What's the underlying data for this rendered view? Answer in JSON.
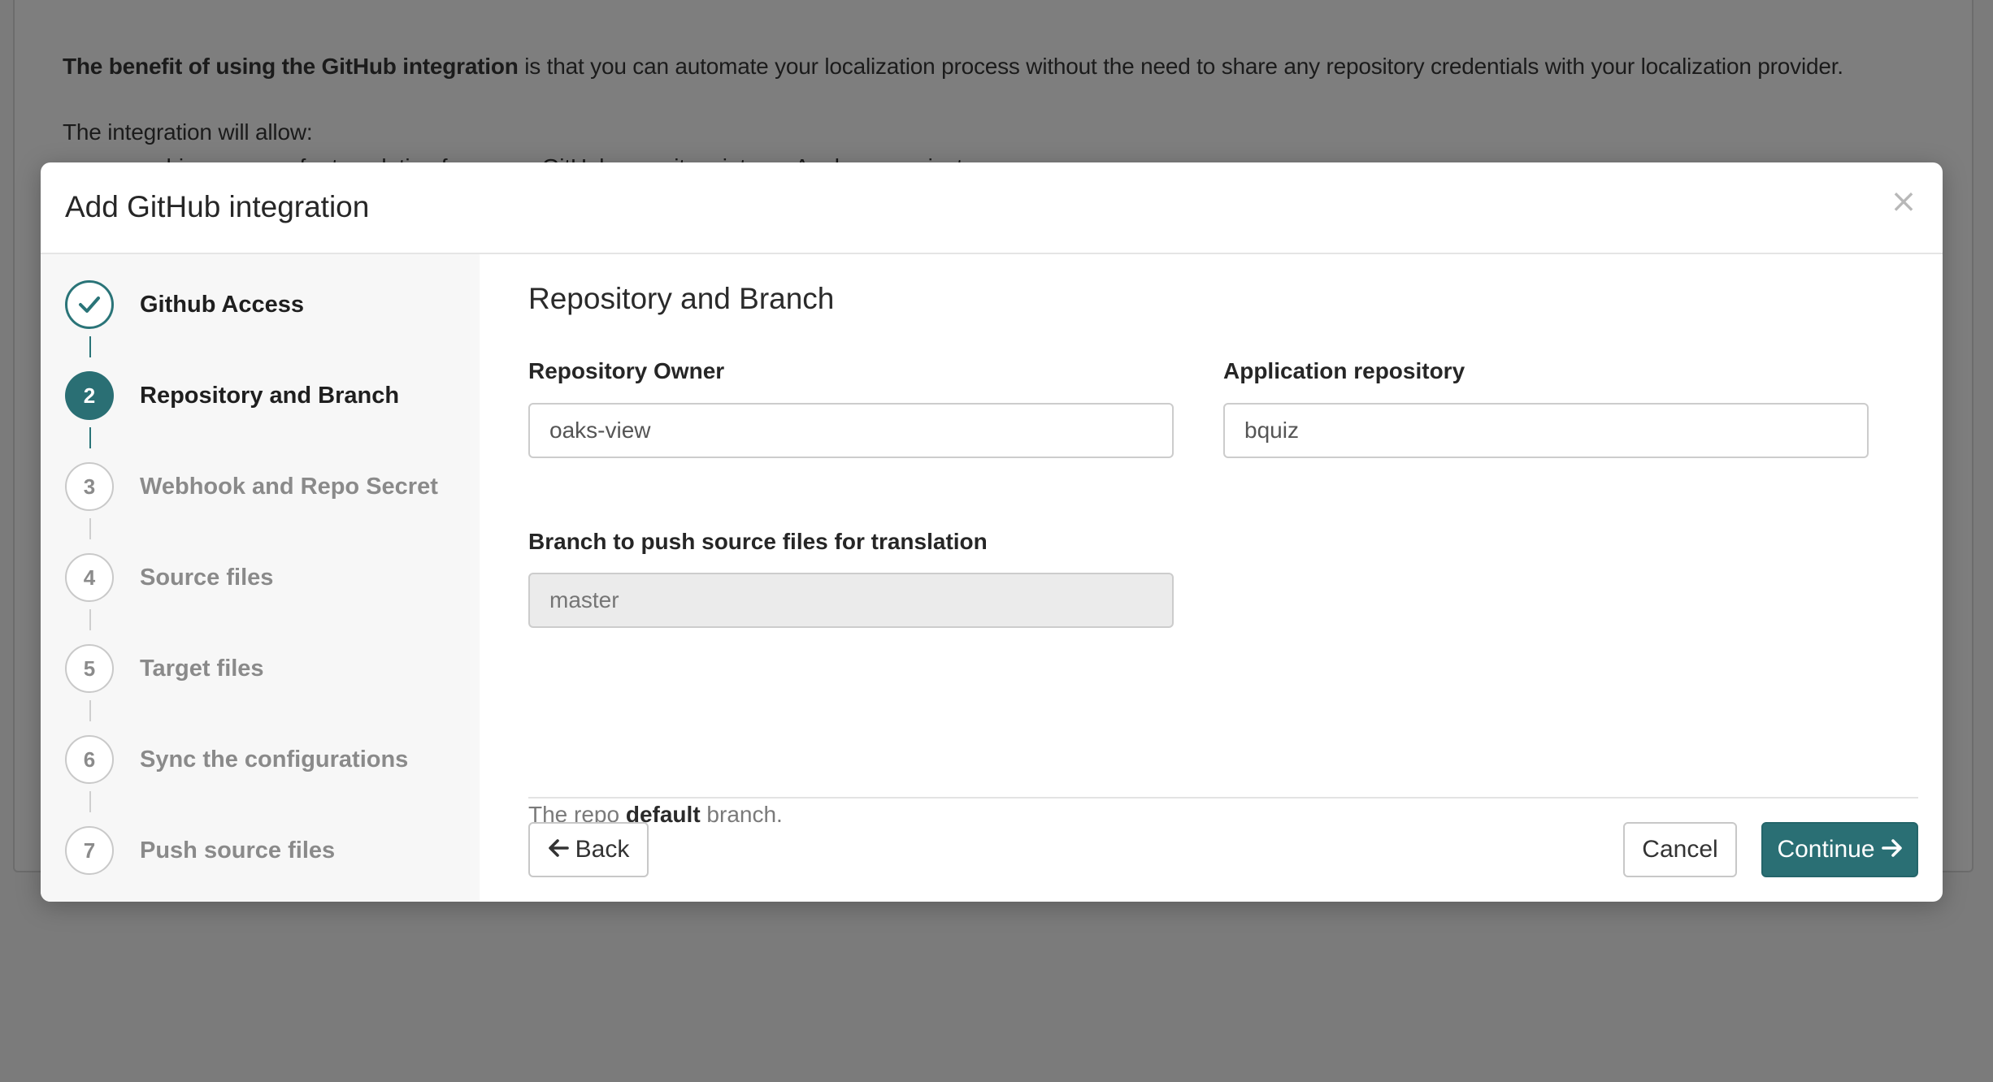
{
  "background": {
    "benefit_bold": "The benefit of using the GitHub integration",
    "benefit_rest": " is that you can automate your localization process without the need to share any repository credentials with your localization provider.",
    "allow_text": "The integration will allow:",
    "partial_line": "pushing sources for translation from your GitHub repository into an Applanga project"
  },
  "modal": {
    "title": "Add GitHub integration",
    "close_glyph": "×"
  },
  "steps": [
    {
      "number": "✓",
      "label": "Github Access",
      "state": "done"
    },
    {
      "number": "2",
      "label": "Repository and Branch",
      "state": "active"
    },
    {
      "number": "3",
      "label": "Webhook and Repo Secret",
      "state": "pending"
    },
    {
      "number": "4",
      "label": "Source files",
      "state": "pending"
    },
    {
      "number": "5",
      "label": "Target files",
      "state": "pending"
    },
    {
      "number": "6",
      "label": "Sync the configurations",
      "state": "pending"
    },
    {
      "number": "7",
      "label": "Push source files",
      "state": "pending"
    }
  ],
  "form": {
    "section_title": "Repository and Branch",
    "owner_label": "Repository Owner",
    "owner_value": "oaks-view",
    "repo_label": "Application repository",
    "repo_value": "bquiz",
    "branch_label": "Branch to push source files for translation",
    "branch_placeholder": "master",
    "help_prefix": "The repo ",
    "help_bold": "default",
    "help_suffix": " branch."
  },
  "buttons": {
    "back_label": "Back",
    "cancel_label": "Cancel",
    "continue_label": "Continue"
  },
  "colors": {
    "accent": "#2a6f74",
    "overlay": "#7b7b7b"
  }
}
